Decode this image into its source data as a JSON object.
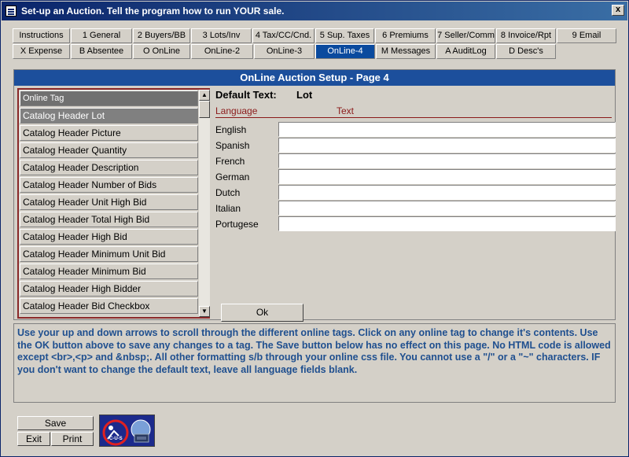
{
  "window": {
    "title": "Set-up an Auction.   Tell the program how to run YOUR sale.",
    "close_glyph": "x"
  },
  "tabs_row1": [
    {
      "label": "Instructions"
    },
    {
      "label": "1 General"
    },
    {
      "label": "2 Buyers/BB"
    },
    {
      "label": "3 Lots/Inv"
    },
    {
      "label": "4 Tax/CC/Cnd."
    },
    {
      "label": "5 Sup. Taxes"
    },
    {
      "label": "6 Premiums"
    },
    {
      "label": "7 Seller/Comm"
    },
    {
      "label": "8 Invoice/Rpt"
    },
    {
      "label": "9 Email"
    }
  ],
  "tabs_row2": [
    {
      "label": "X Expense"
    },
    {
      "label": "B Absentee"
    },
    {
      "label": "O OnLine"
    },
    {
      "label": "OnLine-2"
    },
    {
      "label": "OnLine-3"
    },
    {
      "label": "OnLine-4",
      "active": true
    },
    {
      "label": "M Messages"
    },
    {
      "label": "A AuditLog"
    },
    {
      "label": "D Desc's"
    }
  ],
  "panel": {
    "title": "OnLine Auction Setup - Page 4"
  },
  "tag_list": {
    "header": "Online Tag",
    "items": [
      "Catalog Header Lot",
      "Catalog Header Picture",
      "Catalog Header Quantity",
      "Catalog Header Description",
      "Catalog Header Number of Bids",
      "Catalog Header Unit High Bid",
      "Catalog Header Total High Bid",
      "Catalog Header High Bid",
      "Catalog Header Minimum Unit Bid",
      "Catalog Header Minimum Bid",
      "Catalog Header High Bidder",
      "Catalog Header Bid Checkbox"
    ],
    "selected_index": 0,
    "scroll_up": "▲",
    "scroll_down": "▼"
  },
  "editor": {
    "default_label": "Default Text:",
    "default_value": "Lot",
    "col_language": "Language",
    "col_text": "Text",
    "languages": [
      {
        "name": "English",
        "value": ""
      },
      {
        "name": "Spanish",
        "value": ""
      },
      {
        "name": "French",
        "value": ""
      },
      {
        "name": "German",
        "value": ""
      },
      {
        "name": "Dutch",
        "value": ""
      },
      {
        "name": "Italian",
        "value": ""
      },
      {
        "name": "Portugese",
        "value": ""
      }
    ],
    "ok_label": "Ok"
  },
  "help_text": "Use your up and down arrows to scroll through the different online tags. Click on any online tag to change it's contents. Use the OK button above to save any changes to a tag. The Save button below has no effect on this page. No HTML code is allowed except <br>,<p> and &nbsp;.  All other formatting s/b through your online css file. You cannot use a \"/\" or a \"~\" characters. IF you don't want to change the default text, leave all language fields blank.",
  "footer": {
    "save_label": "Save",
    "exit_label": "Exit",
    "print_label": "Print",
    "logo_text": "C-U-S"
  }
}
